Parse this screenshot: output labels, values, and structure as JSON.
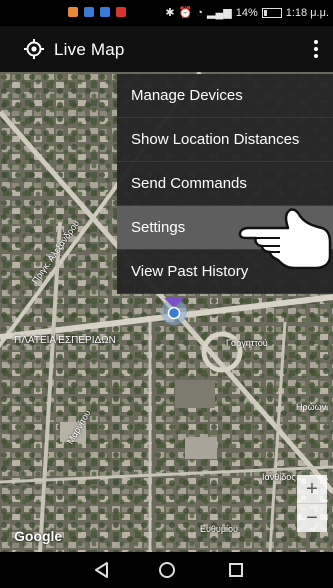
{
  "status_bar": {
    "battery_text": "14%",
    "time": "1:18 μ.μ.",
    "notification_colors": [
      "#e8893a",
      "#3a7bd5",
      "#3a7bd5",
      "#d9342b"
    ]
  },
  "app_bar": {
    "title": "Live Map",
    "crosshair_icon": "crosshair-icon",
    "overflow_icon": "more-vert-icon"
  },
  "menu": {
    "items": [
      {
        "label": "Manage Devices"
      },
      {
        "label": "Show Location Distances"
      },
      {
        "label": "Send Commands"
      },
      {
        "label": "Settings"
      },
      {
        "label": "View Past History"
      }
    ],
    "highlighted_index": 3
  },
  "map": {
    "labels": {
      "square": "ΠΛΑΤΕΙΑ ΕΣΠΕΡΙΔΩΝ",
      "street_a": "Ιανθίδος",
      "street_b": "Πριγκ. Αλεξάνδρου",
      "street_c": "Μαρνίτου",
      "street_d": "Ευθυμίου",
      "street_e": "Γαργηττού",
      "street_f": "Ηρώων"
    },
    "google_logo": "Google",
    "zoom_in": "+",
    "zoom_out": "−"
  },
  "colors": {
    "app_bar": "#111111",
    "menu_bg": "#262626",
    "menu_highlight": "#5e5e5e",
    "marker_blue": "#3a7bd5",
    "marker_purple": "#7b4fc9"
  }
}
